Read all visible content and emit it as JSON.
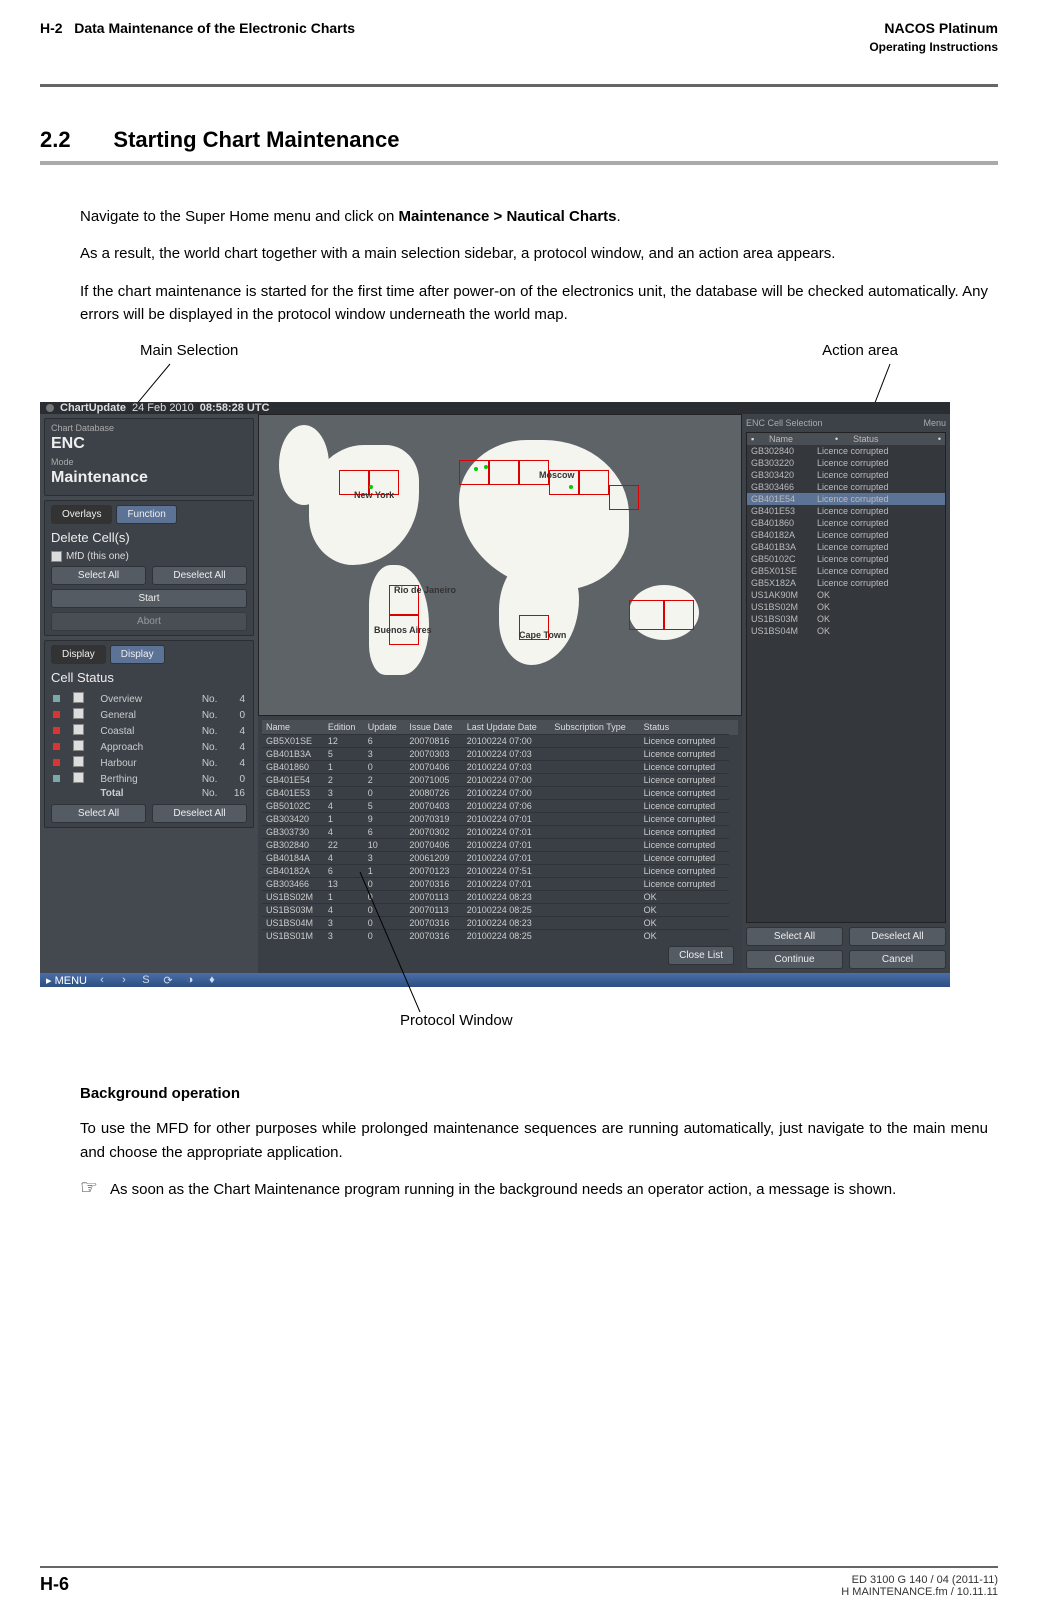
{
  "header": {
    "chapter": "H-2",
    "title": "Data Maintenance of the Electronic Charts",
    "product": "NACOS Platinum",
    "subtitle": "Operating Instructions"
  },
  "section": {
    "number": "2.2",
    "title": "Starting Chart Maintenance"
  },
  "paragraphs": {
    "p1_a": "Navigate to the Super Home menu and click on ",
    "p1_b": "Maintenance > Nautical Charts",
    "p1_c": ".",
    "p2": "As a result, the world chart together with a main selection sidebar, a protocol window, and an action area appears.",
    "p3": "If the chart maintenance is started for the first time after power-on of the electronics unit, the database will be checked automatically. Any errors will be displayed in the protocol window underneath the world map."
  },
  "annotations": {
    "main_selection": "Main Selection",
    "action_area": "Action area",
    "protocol_window": "Protocol Window"
  },
  "screenshot": {
    "titlebar": {
      "app": "ChartUpdate",
      "date": "24 Feb 2010",
      "time": "08:58:28 UTC"
    },
    "sidebar": {
      "chart_db_label": "Chart Database",
      "chart_db_value": "ENC",
      "mode_label": "Mode",
      "mode_value": "Maintenance",
      "overlays_tab": "Overlays",
      "function_tab": "Function",
      "function_value": "Delete Cell(s)",
      "mfd_label": "MfD (this one)",
      "select_all": "Select All",
      "deselect_all": "Deselect All",
      "start": "Start",
      "abort": "Abort",
      "display_tab": "Display",
      "display_value": "Cell Status",
      "status_rows": [
        {
          "color": "#7aa",
          "name": "Overview",
          "no": "No.",
          "val": "4"
        },
        {
          "color": "#d33",
          "name": "General",
          "no": "No.",
          "val": "0"
        },
        {
          "color": "#d33",
          "name": "Coastal",
          "no": "No.",
          "val": "4"
        },
        {
          "color": "#d33",
          "name": "Approach",
          "no": "No.",
          "val": "4"
        },
        {
          "color": "#d33",
          "name": "Harbour",
          "no": "No.",
          "val": "4"
        },
        {
          "color": "#7aa",
          "name": "Berthing",
          "no": "No.",
          "val": "0"
        }
      ],
      "total_label": "Total",
      "total_no": "No.",
      "total_val": "16"
    },
    "map_labels": {
      "newyork": "New York",
      "moscow": "Moscow",
      "rio": "Rio de Janeiro",
      "buenos": "Buenos Aires",
      "cape": "Cape Town"
    },
    "protocol": {
      "headers": [
        "Name",
        "Edition",
        "Update",
        "Issue Date",
        "Last Update Date",
        "Subscription Type",
        "Status",
        ""
      ],
      "rows": [
        [
          "GB5X01SE",
          "12",
          "6",
          "20070816",
          "20100224 07:00",
          "",
          "Licence corrupted"
        ],
        [
          "GB401B3A",
          "5",
          "3",
          "20070303",
          "20100224 07:03",
          "",
          "Licence corrupted"
        ],
        [
          "GB401860",
          "1",
          "0",
          "20070406",
          "20100224 07:03",
          "",
          "Licence corrupted"
        ],
        [
          "GB401E54",
          "2",
          "2",
          "20071005",
          "20100224 07:00",
          "",
          "Licence corrupted"
        ],
        [
          "GB401E53",
          "3",
          "0",
          "20080726",
          "20100224 07:00",
          "",
          "Licence corrupted"
        ],
        [
          "GB50102C",
          "4",
          "5",
          "20070403",
          "20100224 07:06",
          "",
          "Licence corrupted"
        ],
        [
          "GB303420",
          "1",
          "9",
          "20070319",
          "20100224 07:01",
          "",
          "Licence corrupted"
        ],
        [
          "GB303730",
          "4",
          "6",
          "20070302",
          "20100224 07:01",
          "",
          "Licence corrupted"
        ],
        [
          "GB302840",
          "22",
          "10",
          "20070406",
          "20100224 07:01",
          "",
          "Licence corrupted"
        ],
        [
          "GB40184A",
          "4",
          "3",
          "20061209",
          "20100224 07:01",
          "",
          "Licence corrupted"
        ],
        [
          "GB40182A",
          "6",
          "1",
          "20070123",
          "20100224 07:51",
          "",
          "Licence corrupted"
        ],
        [
          "GB303466",
          "13",
          "0",
          "20070316",
          "20100224 07:01",
          "",
          "Licence corrupted"
        ],
        [
          "US1BS02M",
          "1",
          "0",
          "20070113",
          "20100224 08:23",
          "",
          "OK"
        ],
        [
          "US1BS03M",
          "4",
          "0",
          "20070113",
          "20100224 08:25",
          "",
          "OK"
        ],
        [
          "US1BS04M",
          "3",
          "0",
          "20070316",
          "20100224 08:23",
          "",
          "OK"
        ],
        [
          "US1BS01M",
          "3",
          "0",
          "20070316",
          "20100224 08:25",
          "",
          "OK"
        ]
      ],
      "close_list": "Close List"
    },
    "right": {
      "title": "ENC Cell Selection",
      "menu": "Menu",
      "col_name": "Name",
      "col_status": "Status",
      "cells": [
        {
          "n": "GB302840",
          "s": "Licence corrupted",
          "sel": false
        },
        {
          "n": "GB303220",
          "s": "Licence corrupted",
          "sel": false
        },
        {
          "n": "GB303420",
          "s": "Licence corrupted",
          "sel": false
        },
        {
          "n": "GB303466",
          "s": "Licence corrupted",
          "sel": false
        },
        {
          "n": "GB401E54",
          "s": "Licence corrupted",
          "sel": true
        },
        {
          "n": "GB401E53",
          "s": "Licence corrupted",
          "sel": false
        },
        {
          "n": "GB401860",
          "s": "Licence corrupted",
          "sel": false
        },
        {
          "n": "GB40182A",
          "s": "Licence corrupted",
          "sel": false
        },
        {
          "n": "GB401B3A",
          "s": "Licence corrupted",
          "sel": false
        },
        {
          "n": "GB50102C",
          "s": "Licence corrupted",
          "sel": false
        },
        {
          "n": "GB5X01SE",
          "s": "Licence corrupted",
          "sel": false
        },
        {
          "n": "GB5X182A",
          "s": "Licence corrupted",
          "sel": false
        },
        {
          "n": "US1AK90M",
          "s": "OK",
          "sel": false
        },
        {
          "n": "US1BS02M",
          "s": "OK",
          "sel": false
        },
        {
          "n": "US1BS03M",
          "s": "OK",
          "sel": false
        },
        {
          "n": "US1BS04M",
          "s": "OK",
          "sel": false
        }
      ],
      "select_all": "Select All",
      "deselect_all": "Deselect All",
      "continue": "Continue",
      "cancel": "Cancel"
    },
    "bottombar": {
      "menu": "MENU"
    }
  },
  "background_op": {
    "heading": "Background operation",
    "p1": "To use the MFD for other purposes while prolonged maintenance sequences are running automatically, just navigate to the main menu and choose the appropriate application.",
    "note_icon": "☞",
    "note": "As soon as the Chart Maintenance program running in the background needs an operator action, a message is shown."
  },
  "footer": {
    "page": "H-6",
    "doc": "ED 3100 G 140 / 04 (2011-11)",
    "file": "H MAINTENANCE.fm / 10.11.11"
  }
}
